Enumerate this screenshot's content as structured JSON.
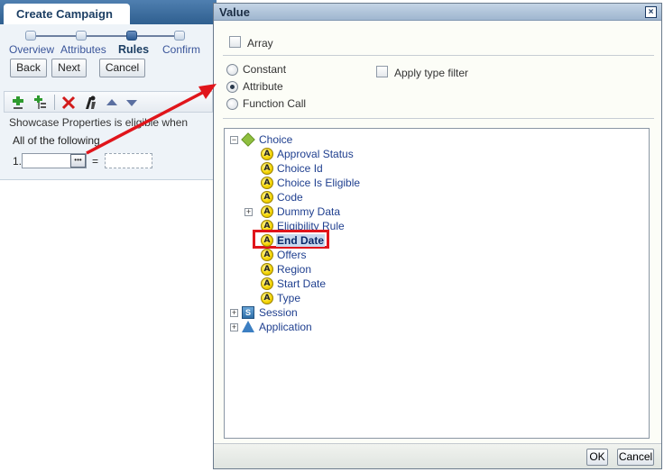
{
  "wizard": {
    "title": "Create Campaign",
    "steps": [
      "Overview",
      "Attributes",
      "Rules",
      "Confirm"
    ],
    "current_step": "Rules",
    "back_label": "Back",
    "next_label": "Next",
    "cancel_label": "Cancel"
  },
  "rules": {
    "eligibility_text": "Showcase Properties is eligible when",
    "condition_group": "All of the following",
    "row_number": "1.",
    "operator": "="
  },
  "dialog": {
    "title": "Value",
    "close_glyph": "×",
    "array_label": "Array",
    "value_types": [
      "Constant",
      "Attribute",
      "Function Call"
    ],
    "selected_value_type": "Attribute",
    "apply_type_filter_label": "Apply type filter",
    "ok_label": "OK",
    "cancel_label": "Cancel"
  },
  "tree": {
    "choice": {
      "label": "Choice",
      "expander": "−",
      "children": [
        "Approval Status",
        "Choice Id",
        "Choice Is Eligible",
        "Code",
        "Dummy Data",
        "Eligibility Rule",
        "End Date",
        "Offers",
        "Region",
        "Start Date",
        "Type"
      ],
      "expandable_child": "Dummy Data",
      "selected_child": "End Date"
    },
    "session": {
      "label": "Session",
      "expander": "+"
    },
    "application": {
      "label": "Application",
      "expander": "+"
    }
  },
  "colors": {
    "selection_highlight": "#e0151b",
    "annotation_arrow": "#e0151b",
    "link_text": "#1f3f8f",
    "title_bar": "#9fb6cf"
  },
  "icons": {
    "attribute": "attribute-a-icon",
    "group": "group-diamond-icon",
    "session": "session-s-icon",
    "application": "application-triangle-icon"
  }
}
